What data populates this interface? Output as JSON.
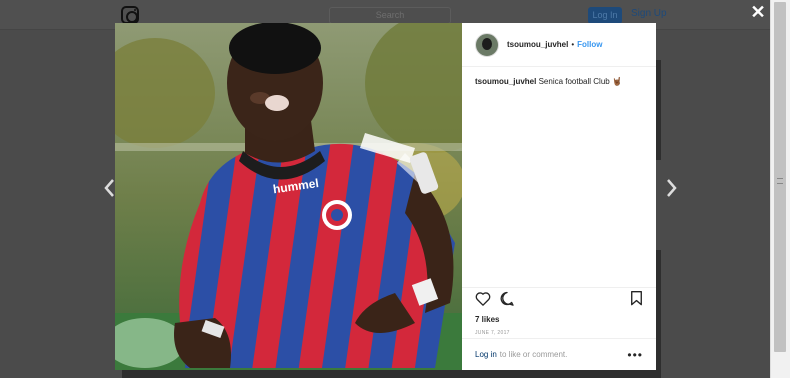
{
  "background": {
    "search_placeholder": "Search",
    "login_label": "Log In",
    "signup_label": "Sign Up"
  },
  "post": {
    "username": "tsoumou_juvhel",
    "follow_label": "Follow",
    "separator": "•",
    "caption_user": "tsoumou_juvhel",
    "caption_text": "Senica football Club 🤘🏾",
    "likes": "7 likes",
    "date": "JUNE 7, 2017",
    "login_link": "Log in",
    "comment_prompt": "to like or comment.",
    "more_label": "•••",
    "jersey_brand": "hummel"
  },
  "controls": {
    "close_label": "✕"
  },
  "icons": {
    "logo": "instagram-logo-icon",
    "like": "heart-icon",
    "comment": "comment-icon",
    "save": "bookmark-icon",
    "prev": "chevron-left-icon",
    "next": "chevron-right-icon"
  }
}
